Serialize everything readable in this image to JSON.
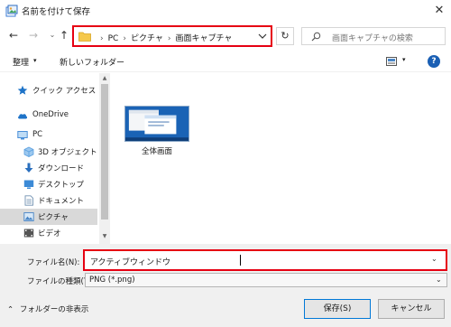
{
  "window": {
    "title": "名前を付けて保存",
    "close_glyph": "✕"
  },
  "nav": {
    "back": "←",
    "forward": "→",
    "recent": "⌄",
    "up": "↑",
    "breadcrumb": [
      "PC",
      "ピクチャ",
      "画面キャプチャ"
    ],
    "refresh": "↻",
    "search_placeholder": "画面キャプチャの検索"
  },
  "toolbar": {
    "organize": "整理",
    "organize_caret": "▾",
    "new_folder": "新しいフォルダー",
    "view_caret": "▾",
    "help": "?"
  },
  "sidebar": {
    "items": [
      {
        "label": "クイック アクセス",
        "icon": "star-icon",
        "color": "#1e73c8"
      },
      {
        "label": "OneDrive",
        "icon": "cloud-icon",
        "color": "#1e73c8"
      },
      {
        "label": "PC",
        "icon": "computer-icon",
        "color": "#4a8fd8"
      },
      {
        "label": "3D オブジェクト",
        "icon": "cube-icon",
        "color": "#5aa0e0"
      },
      {
        "label": "ダウンロード",
        "icon": "download-icon",
        "color": "#2a6fbe"
      },
      {
        "label": "デスクトップ",
        "icon": "desktop-icon",
        "color": "#3c8ad6"
      },
      {
        "label": "ドキュメント",
        "icon": "document-icon",
        "color": "#6f8fb0"
      },
      {
        "label": "ピクチャ",
        "icon": "picture-icon",
        "color": "#4a86c6",
        "selected": true
      },
      {
        "label": "ビデオ",
        "icon": "video-icon",
        "color": "#555555"
      }
    ],
    "scroll_up": "▲",
    "scroll_down": "▼"
  },
  "content": {
    "files": [
      {
        "name": "全体画面"
      }
    ]
  },
  "bottom": {
    "filename_label": "ファイル名(N):",
    "filename_value": "アクティブウィンドウ",
    "filetype_label": "ファイルの種類(T):",
    "filetype_value": "PNG (*.png)",
    "dropdown_glyph": "⌄",
    "hide_folders": "フォルダーの非表示",
    "hide_folders_caret": "⌃",
    "save": "保存(S)",
    "cancel": "キャンセル"
  },
  "colors": {
    "highlight_border": "#e60012",
    "accent": "#0078d7",
    "thumbnail": "#1a63b5"
  }
}
